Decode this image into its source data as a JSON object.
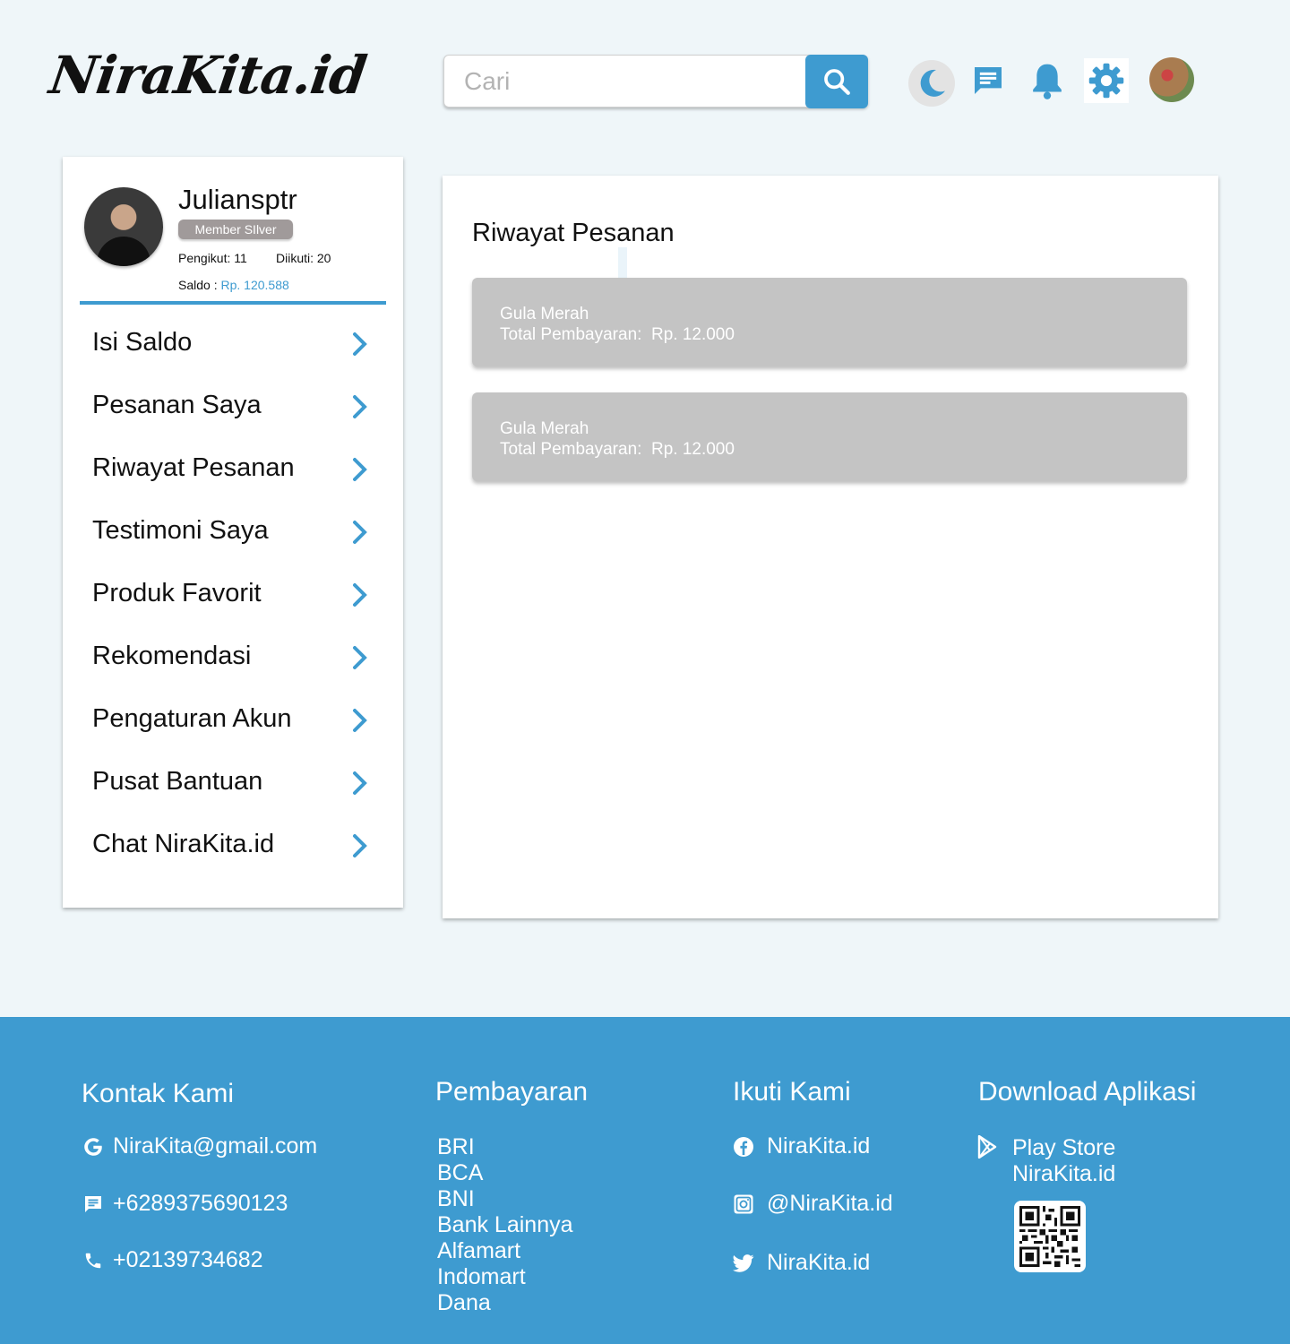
{
  "header": {
    "logo_text": "NiraKita.id",
    "search_placeholder": "Cari",
    "icons": [
      "dark-mode-icon",
      "chat-icon",
      "bell-icon",
      "gear-icon",
      "user-avatar"
    ]
  },
  "profile": {
    "username": "Juliansptr",
    "member_badge": "Member SIlver",
    "followers": "Pengikut: 11",
    "following": "Diikuti: 20",
    "saldo_label": "Saldo : ",
    "saldo_value": "Rp. 120.588"
  },
  "menu": {
    "items": [
      {
        "label": "Isi Saldo"
      },
      {
        "label": "Pesanan Saya"
      },
      {
        "label": "Riwayat Pesanan"
      },
      {
        "label": "Testimoni Saya"
      },
      {
        "label": "Produk Favorit"
      },
      {
        "label": "Rekomendasi"
      },
      {
        "label": "Pengaturan Akun"
      },
      {
        "label": "Pusat Bantuan"
      },
      {
        "label": "Chat NiraKita.id"
      }
    ]
  },
  "main": {
    "title": "Riwayat Pesanan",
    "orders": [
      {
        "product": "Gula Merah",
        "total": "Total Pembayaran:  Rp. 12.000"
      },
      {
        "product": "Gula Merah",
        "total": "Total Pembayaran:  Rp. 12.000"
      }
    ]
  },
  "footer": {
    "contact": {
      "heading": "Kontak Kami",
      "email": "NiraKita@gmail.com",
      "sms": "+6289375690123",
      "phone": "+02139734682"
    },
    "payment": {
      "heading": "Pembayaran",
      "methods": [
        "BRI",
        "BCA",
        "BNI",
        "Bank Lainnya",
        "Alfamart",
        "Indomart",
        "Dana"
      ]
    },
    "social": {
      "heading": "Ikuti Kami",
      "facebook": "NiraKita.id",
      "instagram": "@NiraKita.id",
      "twitter": "NiraKita.id"
    },
    "download": {
      "heading": "Download Aplikasi",
      "store": "Play Store",
      "app_name": "NiraKita.id"
    }
  },
  "colors": {
    "accent": "#3e9bd0",
    "background": "#eff6f9",
    "card_gray": "#c4c4c4"
  }
}
